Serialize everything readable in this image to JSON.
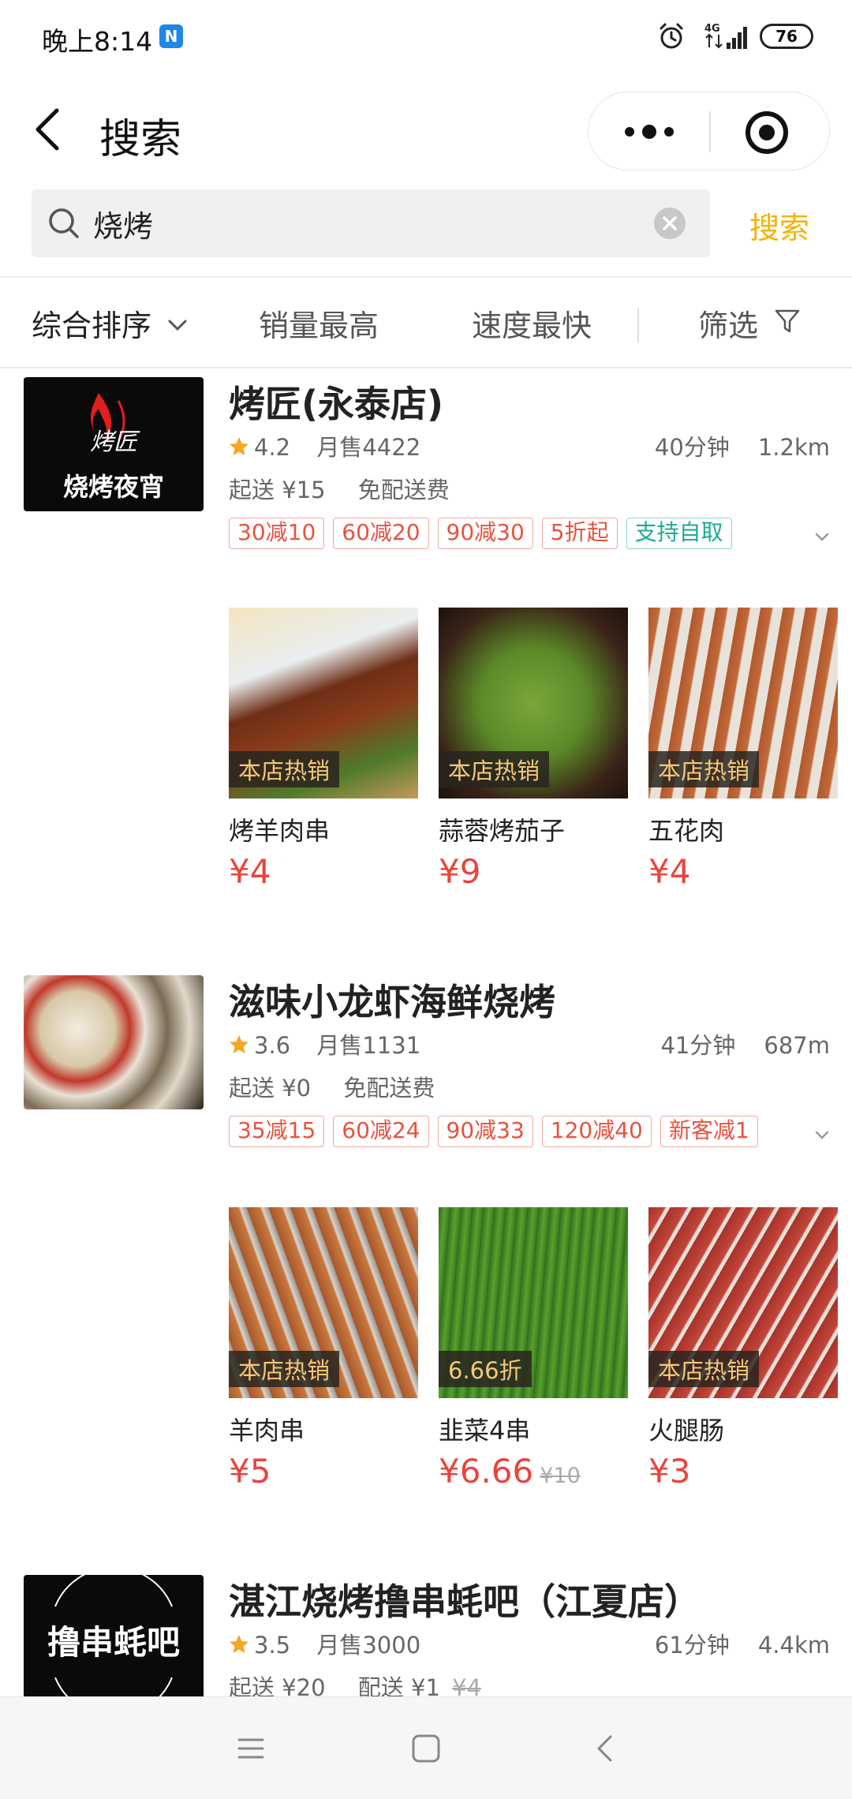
{
  "status_bar": {
    "time": "晚上8:14",
    "n_badge": "N",
    "network": "4G",
    "battery": "76"
  },
  "header": {
    "title": "搜索"
  },
  "search": {
    "value": "烧烤",
    "button": "搜索"
  },
  "sort": {
    "items": [
      "综合排序",
      "销量最高",
      "速度最快"
    ],
    "filter": "筛选"
  },
  "stores": [
    {
      "name": "烤匠(永泰店)",
      "logo_text": "烧烤夜宵",
      "logo_script": "烤匠",
      "rating": "4.2",
      "monthly_sales": "月售4422",
      "time": "40分钟",
      "distance": "1.2km",
      "min_order": "起送 ¥15",
      "delivery": "免配送费",
      "tags": [
        "30减10",
        "60减20",
        "90减30",
        "5折起",
        "支持自取"
      ],
      "dishes": [
        {
          "badge": "本店热销",
          "name": "烤羊肉串",
          "price": "¥4"
        },
        {
          "badge": "本店热销",
          "name": "蒜蓉烤茄子",
          "price": "¥9"
        },
        {
          "badge": "本店热销",
          "name": "五花肉",
          "price": "¥4"
        }
      ]
    },
    {
      "name": "滋味小龙虾海鲜烧烤",
      "rating": "3.6",
      "monthly_sales": "月售1131",
      "time": "41分钟",
      "distance": "687m",
      "min_order": "起送 ¥0",
      "delivery": "免配送费",
      "tags": [
        "35减15",
        "60减24",
        "90减33",
        "120减40",
        "新客减1"
      ],
      "dishes": [
        {
          "badge": "本店热销",
          "name": "羊肉串",
          "price": "¥5"
        },
        {
          "badge": "6.66折",
          "name": "韭菜4串",
          "price": "¥6.66",
          "original_price": "¥10"
        },
        {
          "badge": "本店热销",
          "name": "火腿肠",
          "price": "¥3"
        }
      ]
    },
    {
      "name": "湛江烧烤撸串蚝吧（江夏店）",
      "logo_text": "撸串蚝吧",
      "rating": "3.5",
      "monthly_sales": "月售3000",
      "time": "61分钟",
      "distance": "4.4km",
      "min_order": "起送 ¥20",
      "delivery": "配送 ¥1",
      "delivery_original": "¥4"
    }
  ],
  "colors": {
    "accent": "#f4b400",
    "price": "#e8453c",
    "tag": "#e8523f",
    "tag_green": "#1aab95"
  }
}
